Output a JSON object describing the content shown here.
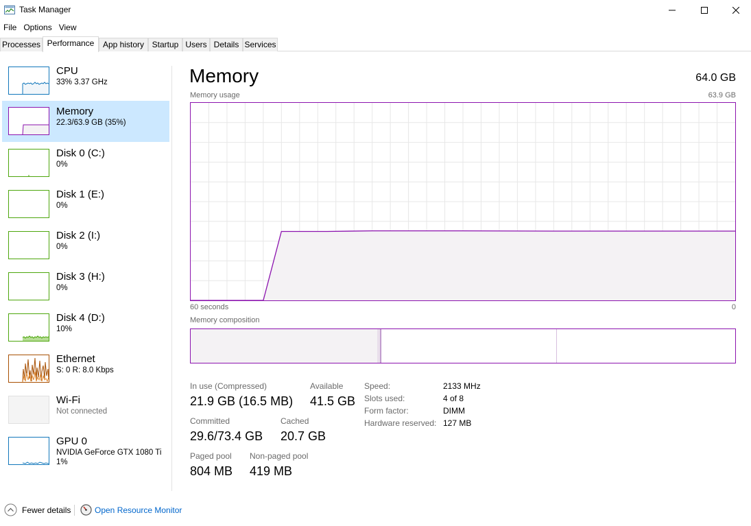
{
  "window": {
    "title": "Task Manager"
  },
  "menu": [
    "File",
    "Options",
    "View"
  ],
  "tabs": [
    {
      "label": "Processes",
      "active": false
    },
    {
      "label": "Performance",
      "active": true
    },
    {
      "label": "App history",
      "active": false
    },
    {
      "label": "Startup",
      "active": false
    },
    {
      "label": "Users",
      "active": false
    },
    {
      "label": "Details",
      "active": false
    },
    {
      "label": "Services",
      "active": false
    }
  ],
  "sidebar": {
    "items": [
      {
        "name": "CPU",
        "sub": "33%  3.37 GHz",
        "color": "#1177bb",
        "selected": false
      },
      {
        "name": "Memory",
        "sub": "22.3/63.9 GB (35%)",
        "color": "#8b12ae",
        "selected": true
      },
      {
        "name": "Disk 0 (C:)",
        "sub": "0%",
        "color": "#4da60c",
        "selected": false
      },
      {
        "name": "Disk 1 (E:)",
        "sub": "0%",
        "color": "#4da60c",
        "selected": false
      },
      {
        "name": "Disk 2 (I:)",
        "sub": "0%",
        "color": "#4da60c",
        "selected": false
      },
      {
        "name": "Disk 3 (H:)",
        "sub": "0%",
        "color": "#4da60c",
        "selected": false
      },
      {
        "name": "Disk 4 (D:)",
        "sub": "10%",
        "color": "#4da60c",
        "selected": false
      },
      {
        "name": "Ethernet",
        "sub": "S: 0  R: 8.0 Kbps",
        "color": "#a74f01",
        "selected": false
      },
      {
        "name": "Wi-Fi",
        "sub": "Not connected",
        "color": "#bfbfbf",
        "selected": false
      },
      {
        "name": "GPU 0",
        "sub": "NVIDIA GeForce GTX 1080 Ti",
        "sub2": "1%",
        "color": "#1177bb",
        "selected": false
      }
    ]
  },
  "main": {
    "title": "Memory",
    "total": "64.0 GB",
    "usage_label": "Memory usage",
    "usage_max": "63.9 GB",
    "axis_left": "60 seconds",
    "axis_right": "0",
    "composition_label": "Memory composition"
  },
  "stats": {
    "in_use_label": "In use (Compressed)",
    "in_use_value": "21.9 GB (16.5 MB)",
    "available_label": "Available",
    "available_value": "41.5 GB",
    "committed_label": "Committed",
    "committed_value": "29.6/73.4 GB",
    "cached_label": "Cached",
    "cached_value": "20.7 GB",
    "paged_label": "Paged pool",
    "paged_value": "804 MB",
    "nonpaged_label": "Non-paged pool",
    "nonpaged_value": "419 MB"
  },
  "specs": {
    "speed_label": "Speed:",
    "speed_value": "2133 MHz",
    "slots_label": "Slots used:",
    "slots_value": "4 of 8",
    "form_label": "Form factor:",
    "form_value": "DIMM",
    "reserved_label": "Hardware reserved:",
    "reserved_value": "127 MB"
  },
  "footer": {
    "fewer_details": "Fewer details",
    "resource_monitor": "Open Resource Monitor"
  },
  "chart_data": {
    "type": "area",
    "x": [
      60,
      56,
      54,
      53,
      52,
      50,
      45,
      40,
      30,
      20,
      10,
      0
    ],
    "series": [
      {
        "values": [
          0,
          0,
          0,
          0,
          0,
          22.3,
          22.3,
          22.5,
          22.5,
          22.4,
          22.4,
          22.4
        ]
      }
    ],
    "xlabel": "60 seconds",
    "ylim": [
      0,
      63.9
    ],
    "grid": true
  },
  "composition": {
    "in_use_fraction": 0.343,
    "modified_fraction": 0.006,
    "standby_fraction": 0.324,
    "free_fraction": 0.327
  },
  "colors": {
    "memory_accent": "#8b12ae",
    "memory_fill": "#f4f2f4",
    "selected_bg": "#cce8ff",
    "link": "#0066cc"
  }
}
